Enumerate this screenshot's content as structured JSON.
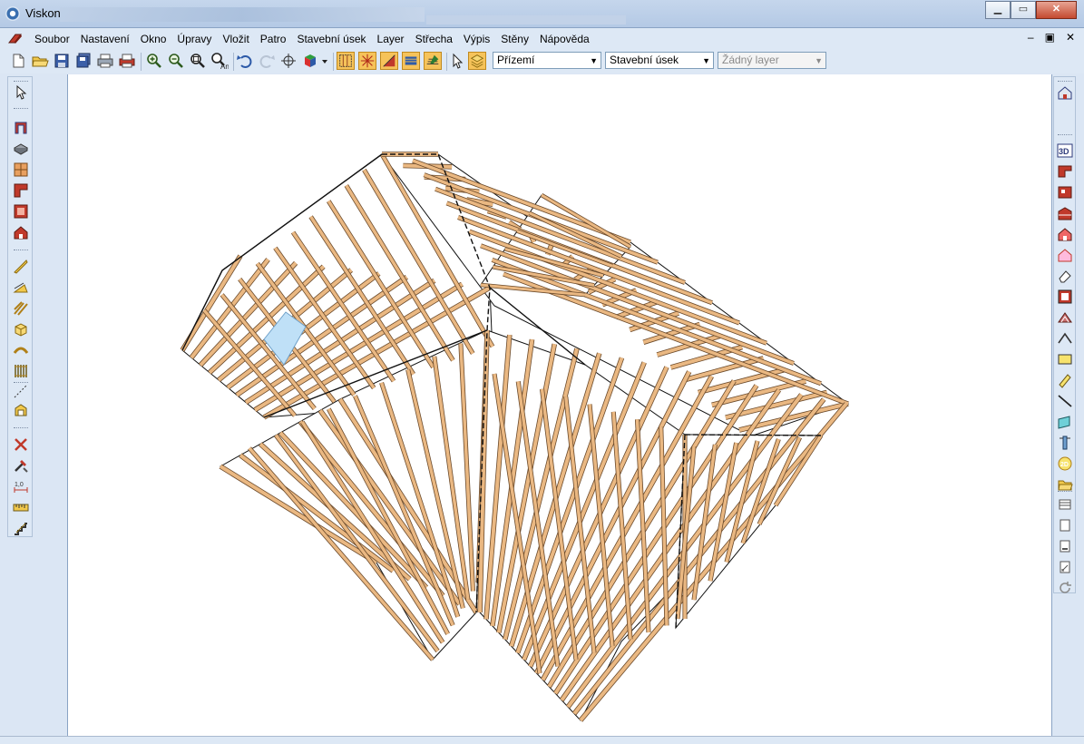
{
  "window": {
    "title": "Viskon"
  },
  "menu": {
    "items": [
      "Soubor",
      "Nastavení",
      "Okno",
      "Úpravy",
      "Vložit",
      "Patro",
      "Stavební úsek",
      "Layer",
      "Střecha",
      "Výpis",
      "Stěny",
      "Nápověda"
    ]
  },
  "mdi": {
    "minimize": "–",
    "restore": "▣",
    "close": "✕"
  },
  "toolbar": {
    "floor_select": {
      "value": "Přízemí"
    },
    "section_select": {
      "value": "Stavební úsek"
    },
    "layer_select": {
      "value": "Žádný layer"
    }
  },
  "colors": {
    "accent": "#f6c35a",
    "timber": "#eab882",
    "timber_edge": "#6b4a2b",
    "skylight": "#bfe0f7"
  }
}
